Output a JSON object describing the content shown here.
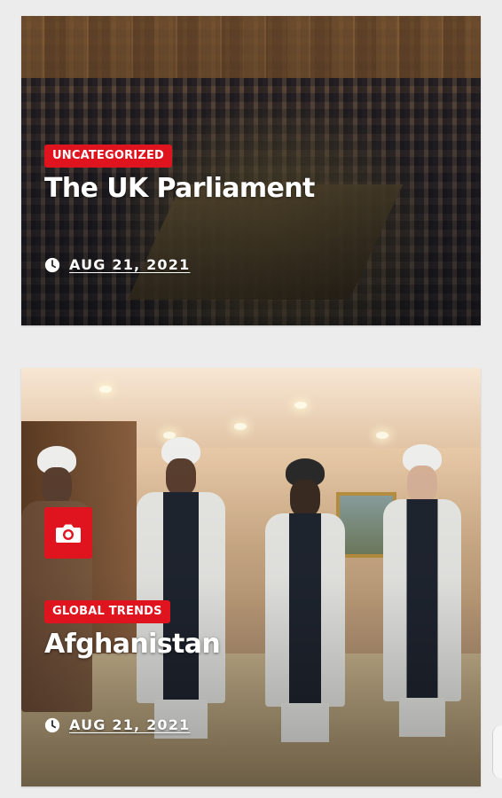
{
  "posts": [
    {
      "category": "UNCATEGORIZED",
      "title": "The UK Parliament",
      "date": "AUG 21, 2021",
      "format_icon": ""
    },
    {
      "category": "GLOBAL TRENDS",
      "title": "Afghanistan",
      "date": "AUG 21, 2021",
      "format_icon": "camera-icon"
    }
  ],
  "colors": {
    "accent": "#e0141e",
    "page_background": "#ececec",
    "text_on_image": "#ffffff"
  },
  "icons": {
    "date": "clock-icon",
    "post_format": "camera-icon"
  }
}
